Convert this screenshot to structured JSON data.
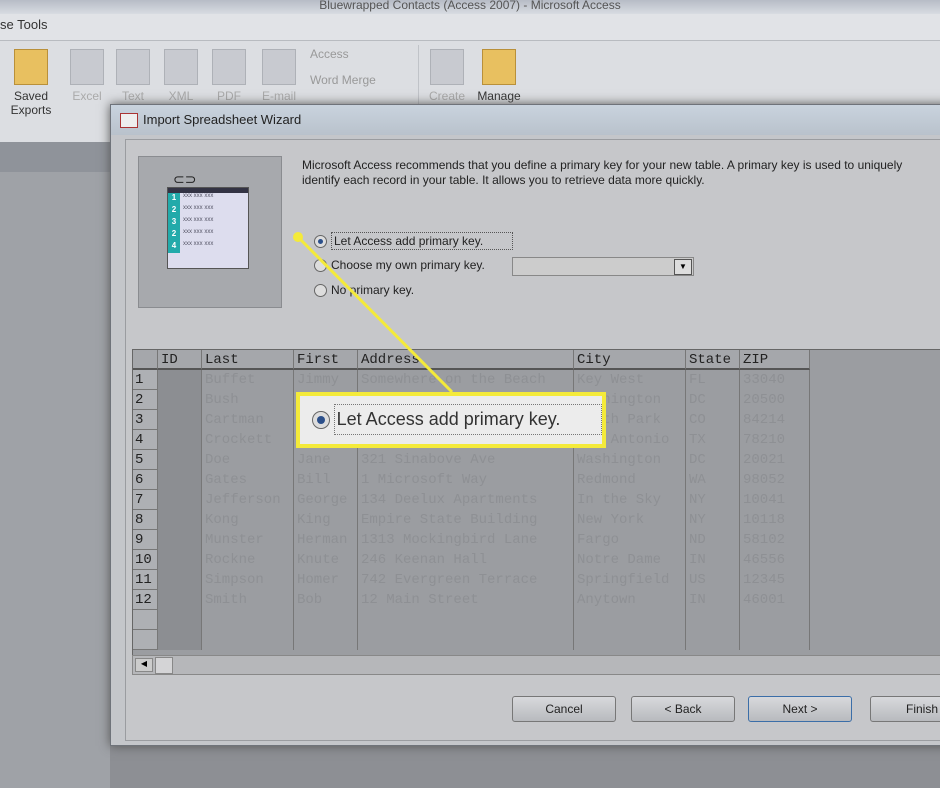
{
  "app_title": "Bluewrapped Contacts (Access 2007) - Microsoft Access",
  "ribbon": {
    "tab": "se Tools",
    "buttons": [
      {
        "label": "Saved Exports",
        "enabled": true,
        "icon": "saved-exports-icon"
      },
      {
        "label": "Excel",
        "icon": "excel-icon"
      },
      {
        "label": "Text",
        "icon": "text-file-icon"
      },
      {
        "label": "XML",
        "icon": "xml-icon"
      },
      {
        "label": "PDF",
        "icon": "pdf-icon"
      },
      {
        "label": "E-mail",
        "icon": "email-icon"
      },
      {
        "label": "Create",
        "icon": "create-icon"
      },
      {
        "label": "Manage",
        "enabled": true,
        "icon": "manage-icon"
      }
    ],
    "small": [
      "Access",
      "Word Merge"
    ]
  },
  "dialog": {
    "title": "Import Spreadsheet Wizard",
    "description": "Microsoft Access recommends that you define a primary key for your new table. A primary key is used to uniquely identify each record in your table. It allows you to retrieve data more quickly.",
    "options": [
      {
        "label": "Let Access add primary key.",
        "selected": true
      },
      {
        "label": "Choose my own primary key.",
        "selected": false
      },
      {
        "label": "No primary key.",
        "selected": false
      }
    ],
    "preview_rows": [
      "1",
      "2",
      "3",
      "2",
      "4"
    ],
    "preview_cell": "xxx xxx xxx",
    "grid": {
      "columns": [
        "ID",
        "Last",
        "First",
        "Address",
        "City",
        "State",
        "ZIP"
      ],
      "rows": [
        [
          "1",
          "",
          "Buffet",
          "Jimmy",
          "Somewhere on the Beach",
          "Key West",
          "FL",
          "33040"
        ],
        [
          "2",
          "",
          "Bush",
          "George",
          "",
          "Washington",
          "DC",
          "20500"
        ],
        [
          "3",
          "",
          "Cartman",
          "Eric",
          "",
          "South Park",
          "CO",
          "84214"
        ],
        [
          "4",
          "",
          "Crockett",
          "Davy",
          "",
          "San Antonio",
          "TX",
          "78210"
        ],
        [
          "5",
          "",
          "Doe",
          "Jane",
          "321 Sinabove Ave",
          "Washington",
          "DC",
          "20021"
        ],
        [
          "6",
          "",
          "Gates",
          "Bill",
          "1 Microsoft Way",
          "Redmond",
          "WA",
          "98052"
        ],
        [
          "7",
          "",
          "Jefferson",
          "George",
          "134 Deelux Apartments",
          "In the Sky",
          "NY",
          "10041"
        ],
        [
          "8",
          "",
          "Kong",
          "King",
          "Empire State Building",
          "New York",
          "NY",
          "10118"
        ],
        [
          "9",
          "",
          "Munster",
          "Herman",
          "1313 Mockingbird Lane",
          "Fargo",
          "ND",
          "58102"
        ],
        [
          "10",
          "",
          "Rockne",
          "Knute",
          "246 Keenan Hall",
          "Notre Dame",
          "IN",
          "46556"
        ],
        [
          "11",
          "",
          "Simpson",
          "Homer",
          "742 Evergreen Terrace",
          "Springfield",
          "US",
          "12345"
        ],
        [
          "12",
          "",
          "Smith",
          "Bob",
          "12 Main Street",
          "Anytown",
          "IN",
          "46001"
        ],
        [
          "",
          "",
          "",
          "",
          "",
          "",
          "",
          ""
        ],
        [
          "",
          "",
          "",
          "",
          "",
          "",
          "",
          ""
        ]
      ]
    },
    "buttons": {
      "cancel": "Cancel",
      "back": "< Back",
      "next": "Next >",
      "finish": "Finish"
    }
  },
  "callout": {
    "label": "Let Access add primary key.",
    "color": "#f4ea3a"
  }
}
